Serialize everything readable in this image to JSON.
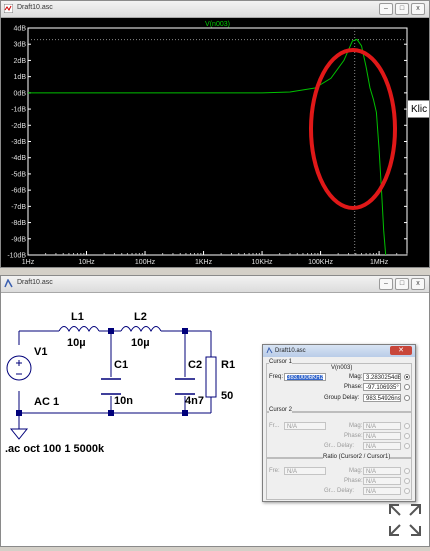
{
  "plot_window": {
    "title": "Draft10.asc",
    "trace_label": "V(n003)",
    "y_ticks": [
      "4dB",
      "3dB",
      "2dB",
      "1dB",
      "0dB",
      "-1dB",
      "-2dB",
      "-3dB",
      "-4dB",
      "-5dB",
      "-6dB",
      "-7dB",
      "-8dB",
      "-9dB",
      "-10dB"
    ],
    "x_ticks": [
      "1Hz",
      "10Hz",
      "100Hz",
      "1KHz",
      "10KHz",
      "100KHz",
      "1MHz"
    ]
  },
  "chart_data": {
    "type": "line",
    "title": "V(n003)",
    "xlabel": "",
    "ylabel": "",
    "x_scale": "log",
    "xlim": [
      1,
      3000000
    ],
    "ylim": [
      -10,
      4
    ],
    "grid": false,
    "series": [
      {
        "name": "V(n003)",
        "color": "#00c000",
        "x": [
          1,
          10,
          100,
          1000,
          10000,
          30000,
          80000,
          150000,
          250000,
          350000,
          420000,
          500000,
          600000,
          700000,
          800000,
          900000,
          1000000,
          1100000,
          1200000,
          1300000
        ],
        "y": [
          0,
          0,
          0,
          0,
          0,
          0.05,
          0.3,
          0.9,
          2.0,
          3.2,
          3.3,
          2.9,
          1.6,
          0.3,
          -0.4,
          -1.2,
          -3.5,
          -6.0,
          -8.5,
          -10.0
        ]
      }
    ],
    "cursor": {
      "x": 383000,
      "y": 3.28
    }
  },
  "tooltip": {
    "text": "Klic"
  },
  "schematic_window": {
    "title": "Draft10.asc",
    "components": {
      "L1": {
        "name": "L1",
        "value": "10µ"
      },
      "L2": {
        "name": "L2",
        "value": "10µ"
      },
      "C1": {
        "name": "C1",
        "value": "10n"
      },
      "C2": {
        "name": "C2",
        "value": "4n7"
      },
      "R1": {
        "name": "R1",
        "value": "50"
      },
      "V1": {
        "name": "V1",
        "value": "AC 1"
      }
    },
    "directive": ".ac oct 100 1 5000k"
  },
  "cursor_dialog": {
    "title": "Draft10.asc",
    "close_label": "✕",
    "cursor1": {
      "group": "Cursor 1",
      "trace": "V(n003)",
      "freq_label": "Freq:",
      "freq_value": "383.0006KHz",
      "mag_label": "Mag:",
      "mag_value": "3.2830254dB",
      "phase_label": "Phase:",
      "phase_value": "-97.106935°",
      "gd_label": "Group Delay:",
      "gd_value": "983.54926ns"
    },
    "cursor2": {
      "group": "Cursor 2",
      "freq_label": "Fr...",
      "freq_value": "N/A",
      "mag_label": "Mag:",
      "mag_value": "N/A",
      "phase_label": "Phase:",
      "phase_value": "N/A",
      "gd_label": "Gr... Delay:",
      "gd_value": "N/A"
    },
    "ratio": {
      "group": "Ratio (Cursor2 / Cursor1)",
      "freq_label": "Fre:",
      "freq_value": "N/A",
      "mag_label": "Mag:",
      "mag_value": "N/A",
      "phase_label": "Phase:",
      "phase_value": "N/A",
      "gd_label": "Gr... Delay:",
      "gd_value": "N/A"
    }
  }
}
